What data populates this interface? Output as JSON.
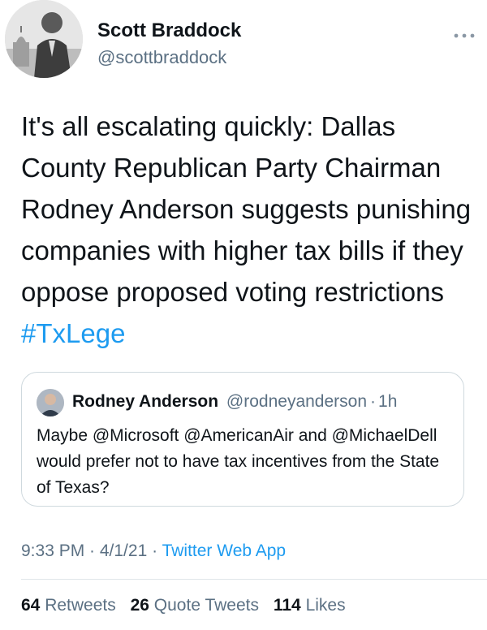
{
  "tweet": {
    "author": {
      "name": "Scott Braddock",
      "handle": "@scottbraddock"
    },
    "more_icon": "more-icon",
    "text_main": "It's all escalating quickly: Dallas County Republican Party Chairman Rodney Anderson suggests punishing companies with higher tax bills if they oppose proposed voting restrictions",
    "hashtag": "#TxLege",
    "quoted": {
      "name": "Rodney Anderson",
      "handle": "@rodneyanderson",
      "separator": "·",
      "time": "1h",
      "text": "Maybe @Microsoft @AmericanAir  and @MichaelDell would prefer not to have tax incentives from the State of Texas?"
    },
    "timestamp": "9:33 PM · 4/1/21",
    "meta_separator": "·",
    "source_app": "Twitter Web App",
    "stats": {
      "retweets_count": "64",
      "retweets_label": "Retweets",
      "quotes_count": "26",
      "quotes_label": "Quote Tweets",
      "likes_count": "114",
      "likes_label": "Likes"
    }
  },
  "colors": {
    "link": "#1d9bf0",
    "secondary_text": "#5b7083",
    "primary_text": "#0f1419",
    "border": "#cfd9de"
  }
}
